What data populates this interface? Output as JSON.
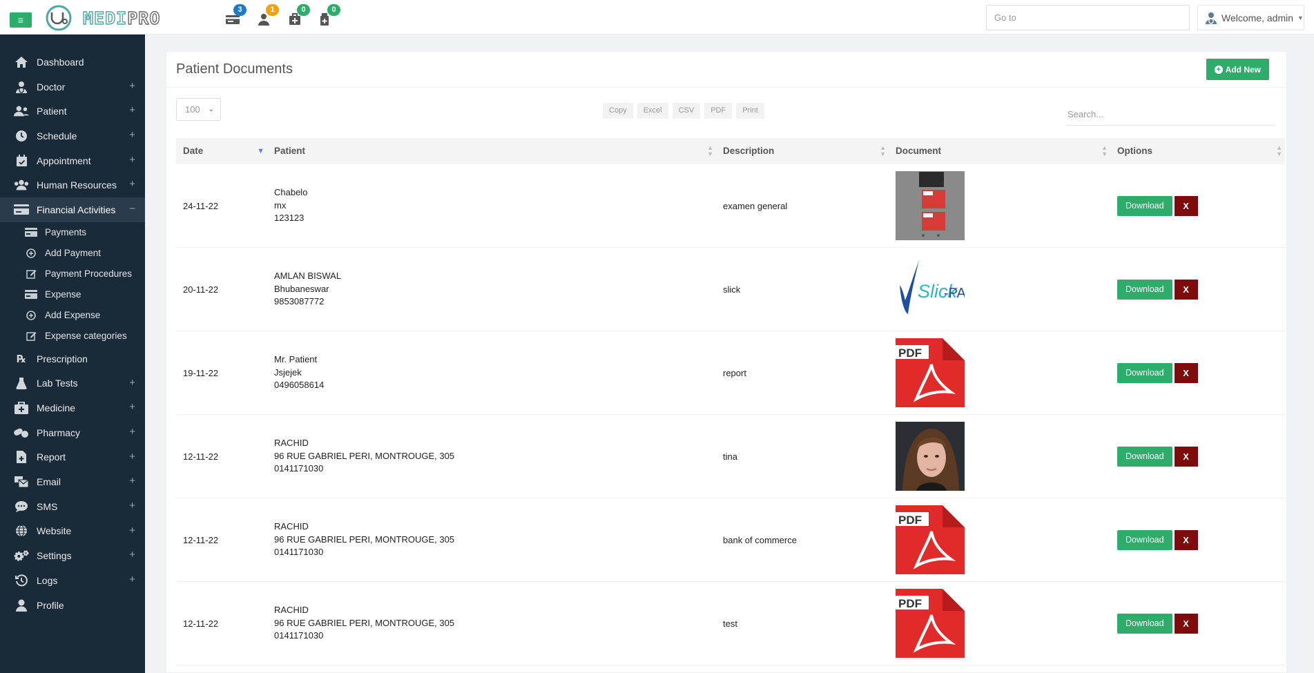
{
  "topbar": {
    "logo_text_a": "MEDI",
    "logo_text_b": "PRO",
    "notifications": [
      {
        "icon": "payments-icon",
        "count": "3",
        "color": "#1e7bbf"
      },
      {
        "icon": "user-icon",
        "count": "1",
        "color": "#f0a30a"
      },
      {
        "icon": "medicine-icon",
        "count": "0",
        "color": "#2eac69"
      },
      {
        "icon": "prescription-icon",
        "count": "0",
        "color": "#2eac69"
      }
    ],
    "goto_placeholder": "Go to",
    "welcome": "Welcome, admin"
  },
  "sidebar": {
    "items": [
      {
        "label": "Dashboard",
        "icon": "home-icon"
      },
      {
        "label": "Doctor",
        "icon": "doctor-icon"
      },
      {
        "label": "Patient",
        "icon": "patients-icon"
      },
      {
        "label": "Schedule",
        "icon": "clock-icon"
      },
      {
        "label": "Appointment",
        "icon": "calendar-check-icon"
      },
      {
        "label": "Human Resources",
        "icon": "users-icon"
      },
      {
        "label": "Financial Activities",
        "icon": "credit-card-icon"
      }
    ],
    "sub_items": [
      {
        "label": "Payments",
        "icon": "money-icon"
      },
      {
        "label": "Add Payment",
        "icon": "plus-circle-icon"
      },
      {
        "label": "Payment Procedures",
        "icon": "edit-icon"
      },
      {
        "label": "Expense",
        "icon": "money-icon"
      },
      {
        "label": "Add Expense",
        "icon": "plus-circle-icon"
      },
      {
        "label": "Expense categories",
        "icon": "edit-icon"
      }
    ],
    "items_after": [
      {
        "label": "Prescription",
        "icon": "rx-icon"
      },
      {
        "label": "Lab Tests",
        "icon": "flask-icon"
      },
      {
        "label": "Medicine",
        "icon": "medkit-icon"
      },
      {
        "label": "Pharmacy",
        "icon": "pills-icon"
      },
      {
        "label": "Report",
        "icon": "file-medical-icon"
      },
      {
        "label": "Email",
        "icon": "mail-bulk-icon"
      },
      {
        "label": "SMS",
        "icon": "sms-icon"
      },
      {
        "label": "Website",
        "icon": "globe-icon"
      },
      {
        "label": "Settings",
        "icon": "cogs-icon"
      },
      {
        "label": "Logs",
        "icon": "history-icon"
      },
      {
        "label": "Profile",
        "icon": "user-icon"
      }
    ],
    "expand_symbol": "+",
    "collapse_symbol": "−"
  },
  "main": {
    "title": "Patient Documents",
    "add_new_label": "Add New",
    "page_length": "100",
    "export_buttons": [
      "Copy",
      "Excel",
      "CSV",
      "PDF",
      "Print"
    ],
    "search_placeholder": "Search...",
    "columns": [
      "Date",
      "Patient",
      "Description",
      "Document",
      "Options"
    ],
    "download_label": "Download",
    "delete_label": "X",
    "rows": [
      {
        "date": "24-11-22",
        "patient": [
          "Chabelo",
          "mx",
          "123123"
        ],
        "description": "examen general",
        "doc": "collage"
      },
      {
        "date": "20-11-22",
        "patient": [
          "AMLAN BISWAL",
          "Bhubaneswar",
          "9853087772"
        ],
        "description": "slick",
        "doc": "slickpay"
      },
      {
        "date": "19-11-22",
        "patient": [
          "Mr. Patient",
          "Jsjejek",
          "0496058614"
        ],
        "description": "report",
        "doc": "pdf"
      },
      {
        "date": "12-11-22",
        "patient": [
          "RACHID",
          "96 RUE GABRIEL PERI, MONTROUGE, 305",
          "0141171030"
        ],
        "description": "tina",
        "doc": "photo"
      },
      {
        "date": "12-11-22",
        "patient": [
          "RACHID",
          "96 RUE GABRIEL PERI, MONTROUGE, 305",
          "0141171030"
        ],
        "description": "bank of commerce",
        "doc": "pdf"
      },
      {
        "date": "12-11-22",
        "patient": [
          "RACHID",
          "96 RUE GABRIEL PERI, MONTROUGE, 305",
          "0141171030"
        ],
        "description": "test",
        "doc": "pdf"
      }
    ]
  },
  "colors": {
    "accent_green": "#2eac69",
    "sidebar_bg": "#1b2a38",
    "delete_red": "#7d0b0b",
    "logo_teal": "#4aa7a9"
  },
  "document_images": {
    "pdf_tag": "PDF",
    "slick_text": "Slick",
    "pay_text": "PAY"
  }
}
